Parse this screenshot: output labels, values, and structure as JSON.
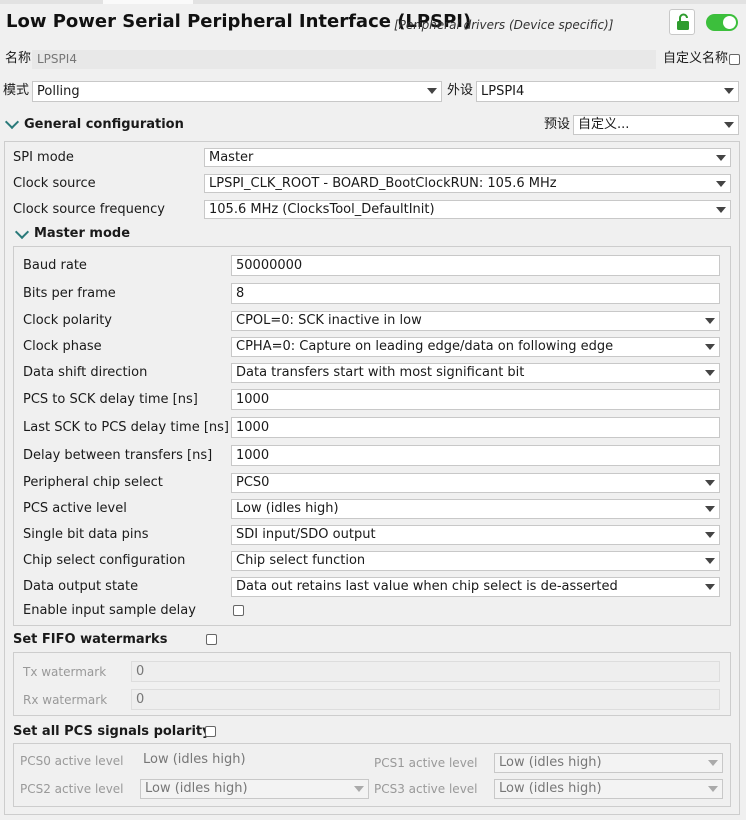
{
  "header": {
    "title": "Low Power Serial Peripheral Interface (LPSPI)",
    "subtitle": "[Peripheral drivers (Device specific)]"
  },
  "name_row": {
    "label": "名称",
    "value": "LPSPI4",
    "custom_label": "自定义名称"
  },
  "mode_row": {
    "label": "模式",
    "value": "Polling",
    "peripheral_label": "外设",
    "peripheral_value": "LPSPI4"
  },
  "general": {
    "title": "General configuration",
    "preset_label": "预设",
    "preset_value": "自定义...",
    "spi_mode_label": "SPI mode",
    "spi_mode_value": "Master",
    "clock_source_label": "Clock source",
    "clock_source_value": "LPSPI_CLK_ROOT - BOARD_BootClockRUN: 105.6 MHz",
    "clock_freq_label": "Clock source frequency",
    "clock_freq_value": "105.6 MHz (ClocksTool_DefaultInit)"
  },
  "master": {
    "title": "Master mode",
    "rows": {
      "baud_rate": {
        "label": "Baud rate",
        "value": "50000000"
      },
      "bits_per_frame": {
        "label": "Bits per frame",
        "value": "8"
      },
      "clock_polarity": {
        "label": "Clock polarity",
        "value": "CPOL=0: SCK inactive in low"
      },
      "clock_phase": {
        "label": "Clock phase",
        "value": "CPHA=0: Capture on leading edge/data on following edge"
      },
      "data_shift": {
        "label": "Data shift direction",
        "value": "Data transfers start with most significant bit"
      },
      "pcs_to_sck": {
        "label": "PCS to SCK delay time [ns]",
        "value": "1000"
      },
      "last_sck_to_pcs": {
        "label": "Last SCK to PCS delay time [ns]",
        "value": "1000"
      },
      "between_transfers": {
        "label": "Delay between transfers [ns]",
        "value": "1000"
      },
      "peripheral_cs": {
        "label": "Peripheral chip select",
        "value": "PCS0"
      },
      "pcs_active_level": {
        "label": "PCS active level",
        "value": "Low (idles high)"
      },
      "single_bit_pins": {
        "label": "Single bit data pins",
        "value": "SDI input/SDO output"
      },
      "cs_config": {
        "label": "Chip select configuration",
        "value": "Chip select function"
      },
      "data_output_state": {
        "label": "Data output state",
        "value": "Data out retains last value when chip select is de-asserted"
      },
      "input_sample_delay": {
        "label": "Enable input sample delay"
      }
    }
  },
  "fifo": {
    "title": "Set FIFO watermarks",
    "tx_label": "Tx watermark",
    "tx_value": "0",
    "rx_label": "Rx watermark",
    "rx_value": "0"
  },
  "pcs_polarity": {
    "title": "Set all PCS signals polarity",
    "pcs0_label": "PCS0 active level",
    "pcs0_value": "Low (idles high)",
    "pcs1_label": "PCS1 active level",
    "pcs1_value": "Low (idles high)",
    "pcs2_label": "PCS2 active level",
    "pcs2_value": "Low (idles high)",
    "pcs3_label": "PCS3 active level",
    "pcs3_value": "Low (idles high)"
  },
  "colors": {
    "toggle_on": "#3cbf3c",
    "lock_icon": "#2e9c2e",
    "chevron": "#2a7a7a"
  }
}
